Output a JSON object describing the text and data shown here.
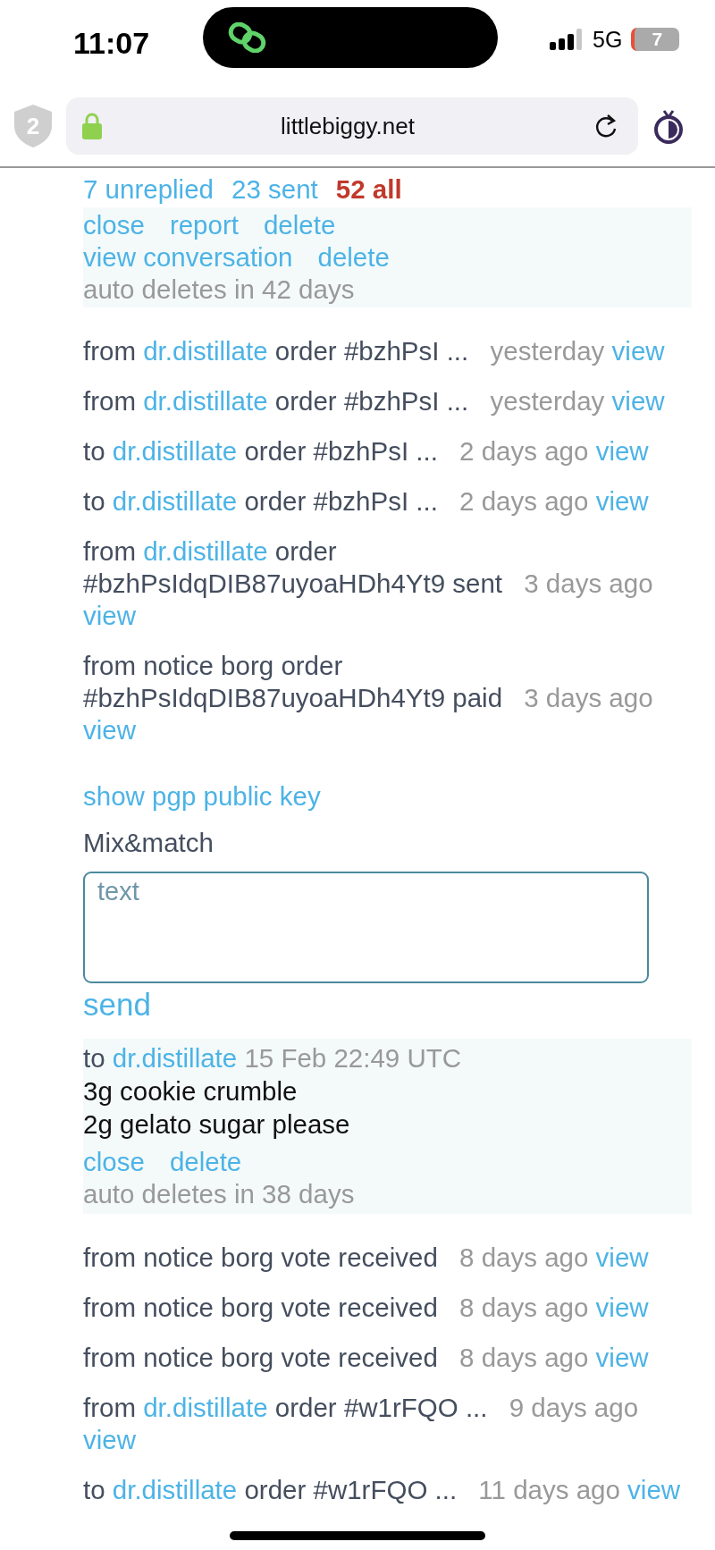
{
  "status_bar": {
    "time": "11:07",
    "network": "5G",
    "battery": "7"
  },
  "browser": {
    "shield_count": "2",
    "url": "littlebiggy.net"
  },
  "filters": [
    {
      "label": "7 unreplied",
      "selected": false
    },
    {
      "label": "23 sent",
      "selected": false
    },
    {
      "label": "52 all",
      "selected": true
    }
  ],
  "open_message": {
    "action_rows": [
      [
        "close",
        "report",
        "delete"
      ],
      [
        "view conversation",
        "delete"
      ]
    ],
    "note": "auto deletes in 42 days"
  },
  "messages": [
    {
      "direction": "from",
      "sender": "dr.distillate",
      "sender_linked": true,
      "subject": "order",
      "detail": "#bzhPsI ...",
      "time": "yesterday",
      "action": "view"
    },
    {
      "direction": "from",
      "sender": "dr.distillate",
      "sender_linked": true,
      "subject": "order",
      "detail": "#bzhPsI ...",
      "time": "yesterday",
      "action": "view"
    },
    {
      "direction": "to",
      "sender": "dr.distillate",
      "sender_linked": true,
      "subject": "order",
      "detail": "#bzhPsI ...",
      "time": "2 days ago",
      "action": "view"
    },
    {
      "direction": "to",
      "sender": "dr.distillate",
      "sender_linked": true,
      "subject": "order",
      "detail": "#bzhPsI ...",
      "time": "2 days ago",
      "action": "view"
    },
    {
      "direction": "from",
      "sender": "dr.distillate",
      "sender_linked": true,
      "subject": "order",
      "detail": "#bzhPsIdqDIB87uyoaHDh4Yt9 sent",
      "time": "3 days ago",
      "action": "view"
    },
    {
      "direction": "from",
      "sender": "notice borg",
      "sender_linked": false,
      "subject": "order",
      "detail": "#bzhPsIdqDIB87uyoaHDh4Yt9 paid",
      "time": "3 days ago",
      "action": "view"
    }
  ],
  "pgp_link": "show pgp public key",
  "compose": {
    "label": "Mix&match",
    "placeholder": "text",
    "send": "send"
  },
  "sent_message": {
    "direction": "to",
    "recipient": "dr.distillate",
    "time": "15 Feb 22:49 UTC",
    "body": [
      "3g cookie crumble",
      "2g gelato sugar please"
    ],
    "actions": [
      "close",
      "delete"
    ],
    "note": "auto deletes in 38 days"
  },
  "messages_2": [
    {
      "direction": "from",
      "sender": "notice borg",
      "sender_linked": false,
      "subject": "vote received",
      "time": "8 days ago",
      "action": "view"
    },
    {
      "direction": "from",
      "sender": "notice borg",
      "sender_linked": false,
      "subject": "vote received",
      "time": "8 days ago",
      "action": "view"
    },
    {
      "direction": "from",
      "sender": "notice borg",
      "sender_linked": false,
      "subject": "vote received",
      "time": "8 days ago",
      "action": "view"
    },
    {
      "direction": "from",
      "sender": "dr.distillate",
      "sender_linked": true,
      "subject": "order",
      "detail": "#w1rFQO ...",
      "time": "9 days ago",
      "action": "view"
    },
    {
      "direction": "to",
      "sender": "dr.distillate",
      "sender_linked": true,
      "subject": "order",
      "detail": "#w1rFQO ...",
      "time": "11 days ago",
      "action": "view"
    }
  ]
}
